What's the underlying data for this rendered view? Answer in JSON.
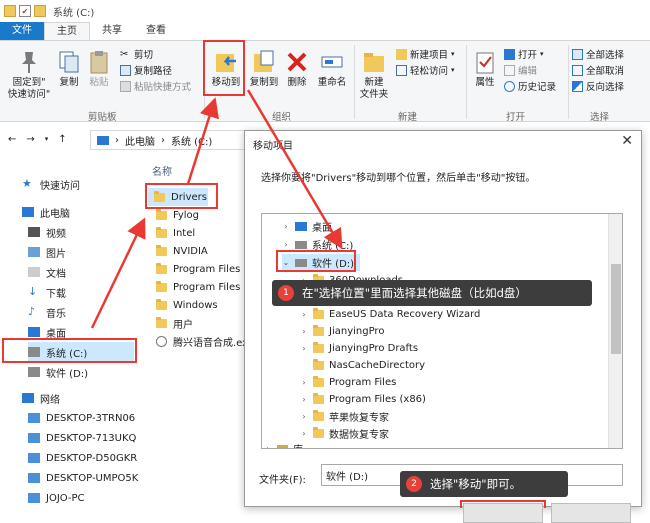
{
  "window": {
    "title": "系统 (C:)"
  },
  "ribbon_tabs": [
    "文件",
    "主页",
    "共享",
    "查看"
  ],
  "ribbon": {
    "pin_label": "固定到\"\n快速访问\"",
    "copy_label": "复制",
    "paste_label": "粘贴",
    "cut_label": "剪切",
    "copy_path_label": "复制路径",
    "paste_shortcut_label": "粘贴快捷方式",
    "clipboard_group": "剪贴板",
    "move_to_label": "移动到",
    "copy_to_label": "复制到",
    "delete_label": "删除",
    "rename_label": "重命名",
    "organize_group": "组织",
    "new_folder_label": "新建\n文件夹",
    "new_item_label": "新建项目",
    "easy_access_label": "轻松访问",
    "new_group": "新建",
    "properties_label": "属性",
    "open_label": "打开",
    "edit_label": "编辑",
    "history_label": "历史记录",
    "open_group": "打开",
    "select_all_label": "全部选择",
    "select_none_label": "全部取消",
    "invert_label": "反向选择",
    "select_group": "选择"
  },
  "address": {
    "this_pc": "此电脑",
    "drive": "系统 (C:)"
  },
  "nav": {
    "items": [
      "快速访问",
      "此电脑",
      "视频",
      "图片",
      "文档",
      "下载",
      "音乐",
      "桌面",
      "系统 (C:)",
      "软件 (D:)",
      "网络",
      "DESKTOP-3TRN06",
      "DESKTOP-713UKQ",
      "DESKTOP-D50GKR",
      "DESKTOP-UMPO5K",
      "JOJO-PC"
    ]
  },
  "files": {
    "column_header": "名称",
    "items": [
      "Drivers",
      "Fylog",
      "Intel",
      "NVIDIA",
      "Program Files",
      "Program Files (",
      "Windows",
      "用户",
      "腾兴语音合成.ex"
    ]
  },
  "dialog": {
    "title": "移动项目",
    "close": "✕",
    "instruction": "选择你要将\"Drivers\"移动到哪个位置，然后单击\"移动\"按钮。",
    "tree": [
      "桌面",
      "系统 (C:)",
      "软件 (D:)",
      "360Downloads",
      "EaseUS Data Recovery Wizard",
      "JianyingPro",
      "JianyingPro Drafts",
      "NasCacheDirectory",
      "Program Files",
      "Program Files (x86)",
      "苹果恢复专家",
      "数据恢复专家",
      "库"
    ],
    "folder_label": "文件夹(F):",
    "folder_value": "软件 (D:)"
  },
  "callouts": {
    "one_num": "1",
    "one_text": "在\"选择位置\"里面选择其他磁盘（比如d盘）",
    "two_num": "2",
    "two_text": "选择\"移动\"即可。"
  },
  "colors": {
    "accent": "#1979ca",
    "highlight": "#e83a33",
    "callout_bg": "#3d3d3d",
    "folder": "#f1c85a"
  }
}
